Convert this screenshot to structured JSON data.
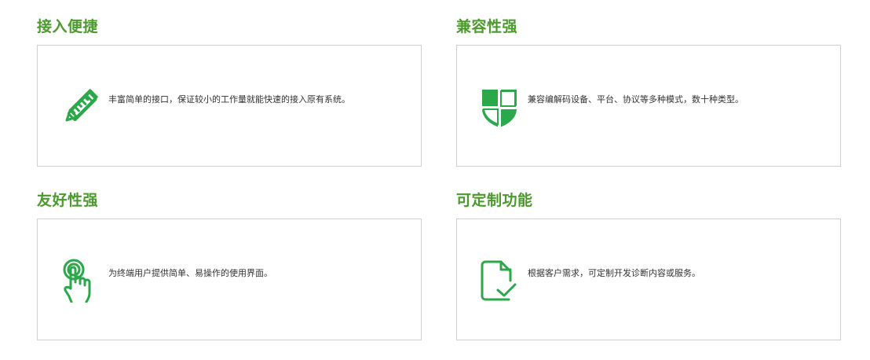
{
  "accent_color": "#2aa84a",
  "title_color": "#4a9a2c",
  "features": [
    {
      "title": "接入便捷",
      "description": "丰富简单的接口，保证较小的工作量就能快速的接入原有系统。",
      "icon": "pencil-ruler-icon"
    },
    {
      "title": "兼容性强",
      "description": "兼容编解码设备、平台、协议等多种模式，数十种类型。",
      "icon": "shield-icon"
    },
    {
      "title": "友好性强",
      "description": "为终端用户提供简单、易操作的使用界面。",
      "icon": "touch-hand-icon"
    },
    {
      "title": "可定制功能",
      "description": "根据客户需求，可定制开发诊断内容或服务。",
      "icon": "document-check-icon"
    }
  ]
}
